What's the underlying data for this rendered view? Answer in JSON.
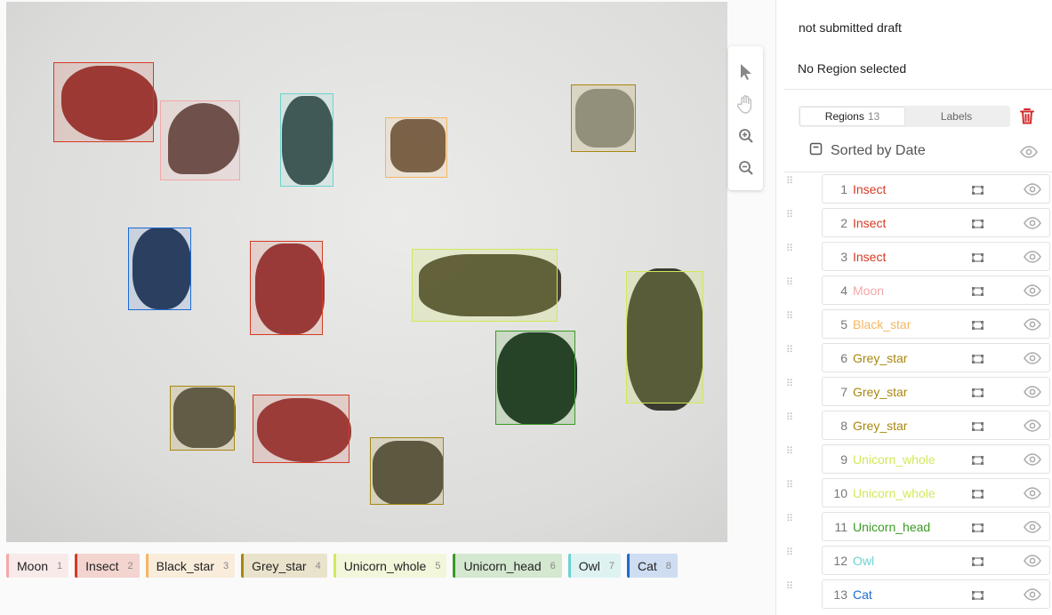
{
  "status": "not submitted draft",
  "selection": "No Region selected",
  "tabs": [
    {
      "label": "Regions",
      "count": "13",
      "active": true
    },
    {
      "label": "Labels",
      "count": "",
      "active": false
    }
  ],
  "sort_label": "Sorted by Date",
  "labels": [
    {
      "name": "Moon",
      "num": "1",
      "color": "#f3a8a8"
    },
    {
      "name": "Insect",
      "num": "2",
      "color": "#d53a24"
    },
    {
      "name": "Black_star",
      "num": "3",
      "color": "#f5b661"
    },
    {
      "name": "Grey_star",
      "num": "4",
      "color": "#a8870e"
    },
    {
      "name": "Unicorn_whole",
      "num": "5",
      "color": "#d2e85a"
    },
    {
      "name": "Unicorn_head",
      "num": "6",
      "color": "#3a9a23"
    },
    {
      "name": "Owl",
      "num": "7",
      "color": "#6dd3d0"
    },
    {
      "name": "Cat",
      "num": "8",
      "color": "#1d6ad4"
    }
  ],
  "regions": [
    {
      "id": "1",
      "label": "Insect",
      "color": "#d53a24"
    },
    {
      "id": "2",
      "label": "Insect",
      "color": "#d53a24"
    },
    {
      "id": "3",
      "label": "Insect",
      "color": "#d53a24"
    },
    {
      "id": "4",
      "label": "Moon",
      "color": "#f3a8a8"
    },
    {
      "id": "5",
      "label": "Black_star",
      "color": "#f5b661"
    },
    {
      "id": "6",
      "label": "Grey_star",
      "color": "#a8870e"
    },
    {
      "id": "7",
      "label": "Grey_star",
      "color": "#a8870e"
    },
    {
      "id": "8",
      "label": "Grey_star",
      "color": "#a8870e"
    },
    {
      "id": "9",
      "label": "Unicorn_whole",
      "color": "#d2e85a"
    },
    {
      "id": "10",
      "label": "Unicorn_whole",
      "color": "#d2e85a"
    },
    {
      "id": "11",
      "label": "Unicorn_head",
      "color": "#3a9a23"
    },
    {
      "id": "12",
      "label": "Owl",
      "color": "#6dd3d0"
    },
    {
      "id": "13",
      "label": "Cat",
      "color": "#1d6ad4"
    }
  ],
  "icons": {
    "select": "cursor-arrow-icon",
    "pan": "hand-pan-icon",
    "zoom_in": "zoom-in-icon",
    "zoom_out": "zoom-out-icon",
    "delete": "trash-icon",
    "visibility": "eye-icon",
    "region_shape": "rectangle-region-icon"
  }
}
